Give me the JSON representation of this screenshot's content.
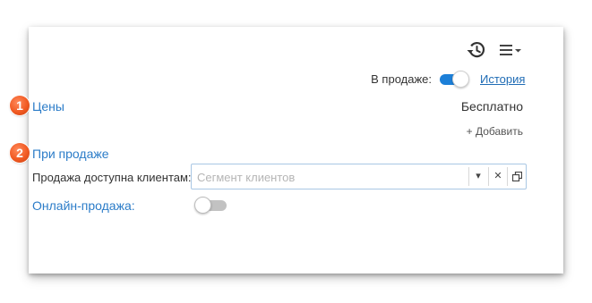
{
  "toolbar": {
    "history_icon": "history-clock-icon",
    "menu_icon": "hamburger-menu-icon"
  },
  "on_sale": {
    "label": "В продаже:",
    "enabled": true,
    "history_link": "История"
  },
  "prices": {
    "badge": "1",
    "title": "Цены",
    "value": "Бесплатно",
    "add_label": "+ Добавить"
  },
  "when_selling": {
    "badge": "2",
    "title": "При продаже",
    "availability_label": "Продажа доступна клиентам:",
    "segment_placeholder": "Сегмент клиентов",
    "segment_value": "",
    "online_label": "Онлайн-продажа:",
    "online_enabled": false
  },
  "colors": {
    "accent": "#1c7fd8",
    "link": "#2b7cc8",
    "badge": "#f15a22"
  }
}
